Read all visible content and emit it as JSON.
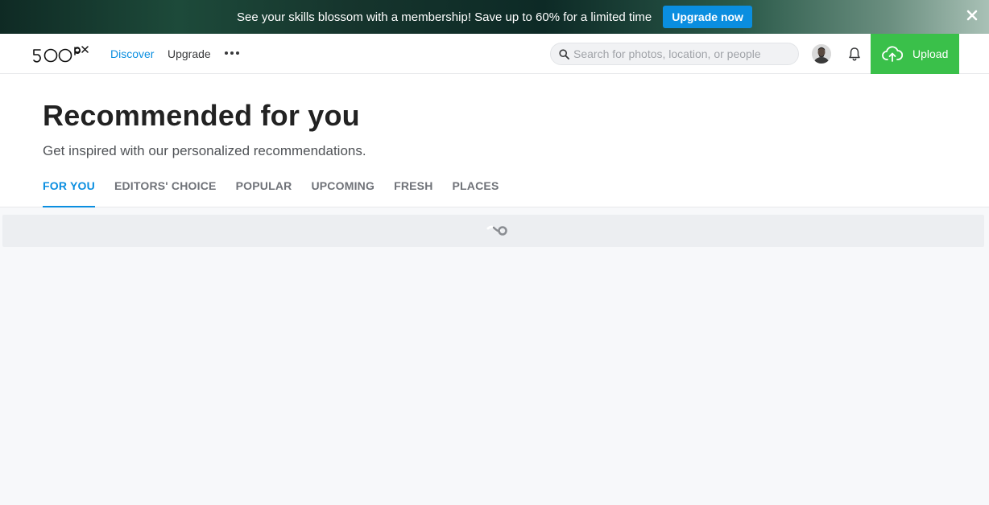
{
  "promo": {
    "text": "See your skills blossom with a membership! Save up to 60% for a limited time",
    "button_label": "Upgrade now",
    "close_icon": "close-icon"
  },
  "nav": {
    "logo_text": "500px",
    "links": [
      "Discover",
      "Upgrade"
    ],
    "more_icon": "more-dots-icon",
    "search_placeholder": "Search for photos, location, or people",
    "upload_label": "Upload"
  },
  "header": {
    "title": "Recommended for you",
    "subtitle": "Get inspired with our personalized recommendations.",
    "tabs": [
      "FOR YOU",
      "EDITORS' CHOICE",
      "POPULAR",
      "UPCOMING",
      "FRESH",
      "PLACES"
    ],
    "active_tab": "FOR YOU"
  },
  "colors": {
    "accent": "#0a8ee0",
    "upload_green": "#3ac04a",
    "page_bg": "#f7f8fa"
  }
}
